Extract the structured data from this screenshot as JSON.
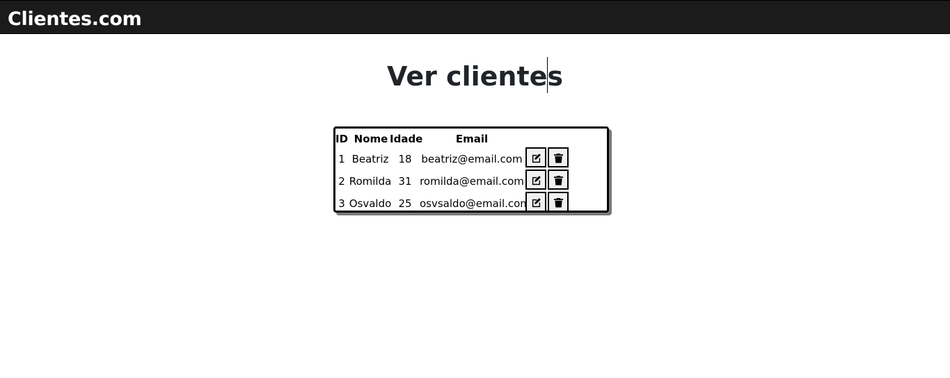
{
  "navbar": {
    "brand": "Clientes.com"
  },
  "page": {
    "title": "Ver clientes"
  },
  "table": {
    "headers": {
      "id": "ID",
      "name": "Nome",
      "age": "Idade",
      "email": "Email"
    },
    "rows": [
      {
        "id": "1",
        "name": "Beatriz",
        "age": "18",
        "email": "beatriz@email.com"
      },
      {
        "id": "2",
        "name": "Romilda",
        "age": "31",
        "email": "romilda@email.com"
      },
      {
        "id": "3",
        "name": "Osvaldo",
        "age": "25",
        "email": "osvsaldo@email.com"
      }
    ],
    "actions": {
      "edit_icon": "edit-icon",
      "delete_icon": "trash-icon"
    }
  },
  "colors": {
    "navbar_bg": "#1b1b1b",
    "brand_text": "#ffffff",
    "title_text": "#212529"
  }
}
